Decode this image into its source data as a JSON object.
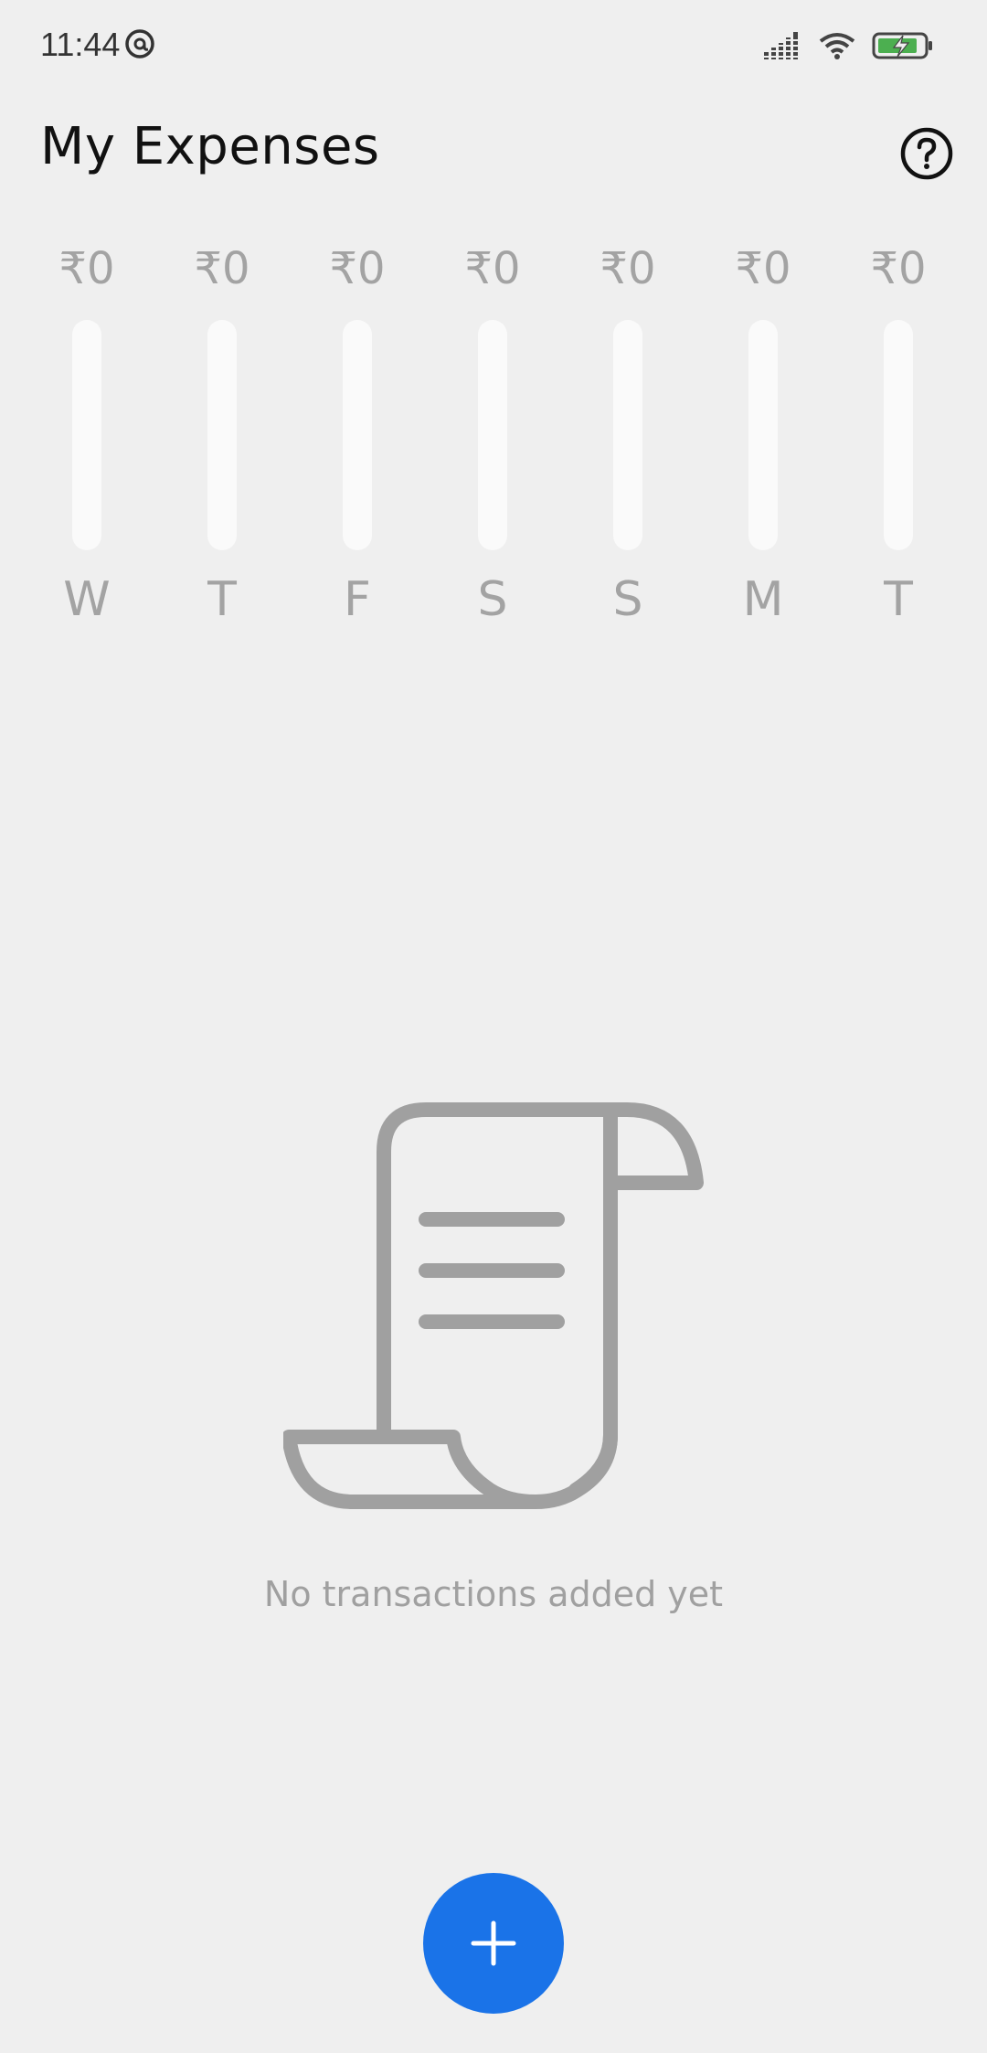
{
  "status_bar": {
    "time": "11:44",
    "app_icon": "at-sign-icon",
    "signal_icon": "cellular-signal-icon",
    "wifi_icon": "wifi-icon",
    "battery_icon": "battery-charging-icon"
  },
  "header": {
    "title": "My Expenses",
    "help_icon": "help-circle-icon"
  },
  "chart_data": {
    "type": "bar",
    "categories": [
      "W",
      "T",
      "F",
      "S",
      "S",
      "M",
      "T"
    ],
    "amount_labels": [
      "₹0",
      "₹0",
      "₹0",
      "₹0",
      "₹0",
      "₹0",
      "₹0"
    ],
    "values": [
      0,
      0,
      0,
      0,
      0,
      0,
      0
    ],
    "title": "",
    "xlabel": "",
    "ylabel": "",
    "grid": false,
    "colors": {
      "track": "#fafafa",
      "fill": "#1a73e8",
      "text": "#a3a3a3"
    }
  },
  "empty_state": {
    "icon": "receipt-scroll-icon",
    "message": "No transactions added yet"
  },
  "fab": {
    "icon": "plus-icon",
    "color": "#1a73e8"
  }
}
